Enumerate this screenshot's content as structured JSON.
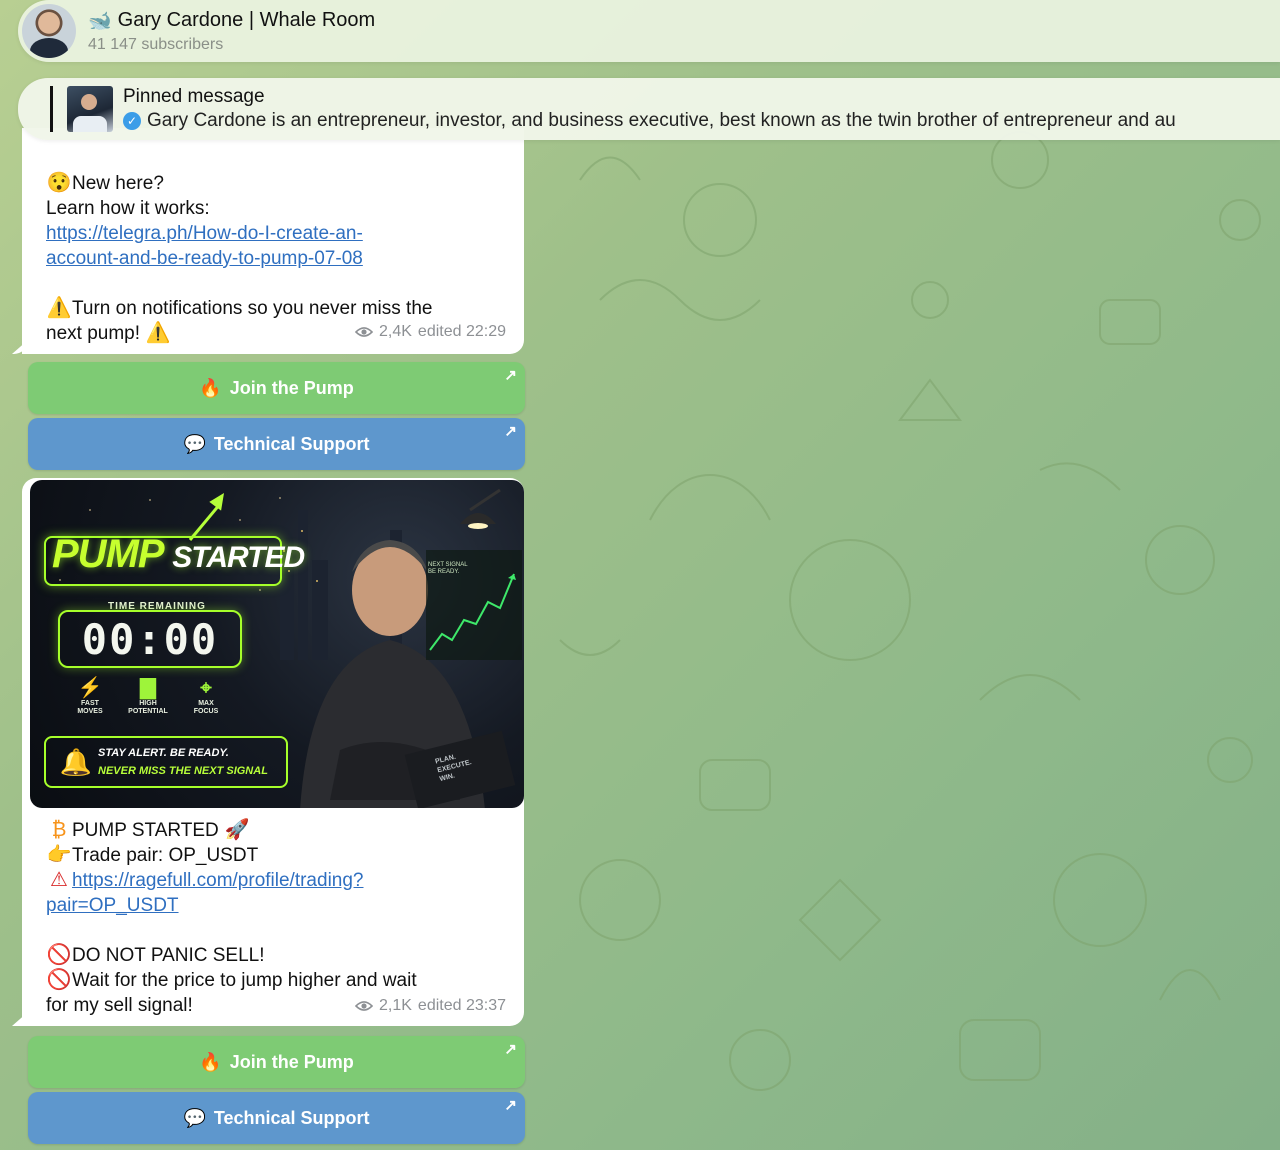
{
  "header": {
    "avatar_icon": "gary-cardone-avatar",
    "channel_icon": "whale-icon",
    "title": "Gary Cardone | Whale Room",
    "subscribers": "41 147 subscribers"
  },
  "pinned": {
    "title": "Pinned message",
    "text": "Gary Cardone is an entrepreneur, investor, and business executive, best known as the twin brother of entrepreneur and au"
  },
  "message1": {
    "new_here": "New here?",
    "learn": "Learn how it works:",
    "link_line1": "https://telegra.ph/How-do-I-create-an-",
    "link_line2": "account-and-be-ready-to-pump-07-08",
    "notify_line1": "Turn on notifications so you never miss the",
    "notify_line2": "next pump!",
    "views": "2,4K",
    "edited": "edited 22:29",
    "buttons": [
      {
        "label": "Join the Pump",
        "icon": "fire-icon"
      },
      {
        "label": "Technical Support",
        "icon": "speech-bubble-icon"
      }
    ]
  },
  "message2": {
    "image": {
      "title_word1": "PUMP",
      "title_word2": "STARTED",
      "time_label": "TIME REMAINING",
      "timer": "00:00",
      "features": [
        {
          "icon": "bolt-icon",
          "line1": "FAST",
          "line2": "MOVES"
        },
        {
          "icon": "signal-bars-icon",
          "line1": "HIGH",
          "line2": "POTENTIAL"
        },
        {
          "icon": "crosshair-icon",
          "line1": "MAX",
          "line2": "FOCUS"
        }
      ],
      "alert_line1": "STAY ALERT. BE READY.",
      "alert_line2": "NEVER MISS THE NEXT SIGNAL",
      "next_signal_line1": "NEXT SIGNAL",
      "next_signal_line2": "BE READY.",
      "book_line1": "PLAN.",
      "book_line2": "EXECUTE.",
      "book_line3": "WIN."
    },
    "pump_started": "PUMP STARTED",
    "trade_pair": "Trade pair: OP_USDT",
    "link_line1": "https://ragefull.com/profile/trading?",
    "link_line2": "pair=OP_USDT",
    "no_panic": "DO NOT PANIC SELL!",
    "wait_line1": "Wait for the price to jump higher and wait",
    "wait_line2": "for my sell signal!",
    "views": "2,1K",
    "edited": "edited 23:37",
    "buttons": [
      {
        "label": "Join the Pump",
        "icon": "fire-icon"
      },
      {
        "label": "Technical Support",
        "icon": "speech-bubble-icon"
      }
    ]
  },
  "colors": {
    "button_green": "#7ecb74",
    "button_blue": "#5e97cd",
    "link": "#2f6fc0",
    "neon_green": "#a6ff2a"
  }
}
